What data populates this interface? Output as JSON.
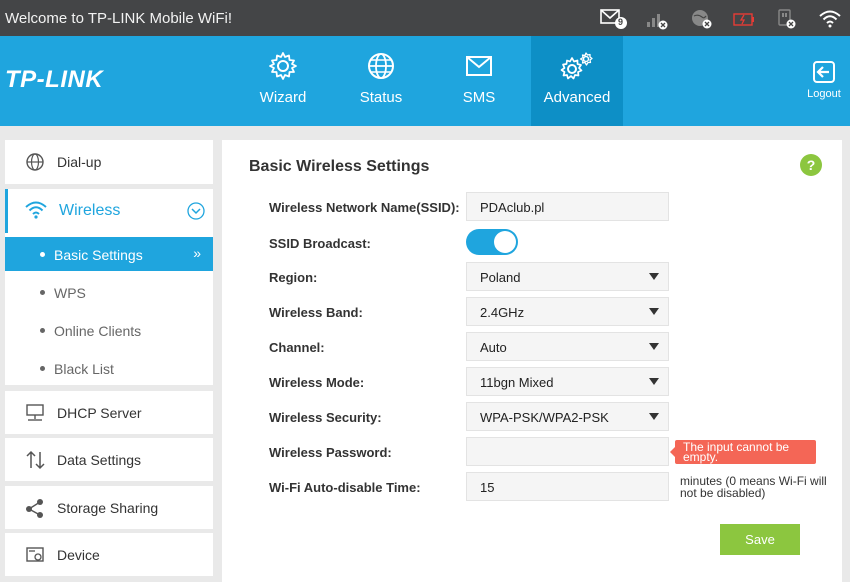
{
  "window": {
    "title": "Welcome to TP-LINK Mobile WiFi!"
  },
  "status_bar": {
    "message_count": "9",
    "icons": [
      "mail-icon",
      "signal-icon",
      "globe-icon",
      "battery-icon",
      "sim-icon",
      "wifi-icon"
    ],
    "battery_color": "#e83b36"
  },
  "header": {
    "logo": "TP-LINK",
    "tabs": [
      {
        "label": "Wizard",
        "icon": "gear-icon"
      },
      {
        "label": "Status",
        "icon": "globe-icon"
      },
      {
        "label": "SMS",
        "icon": "envelope-icon"
      },
      {
        "label": "Advanced",
        "icon": "gears-icon"
      }
    ],
    "active_tab": "Advanced",
    "logout_label": "Logout",
    "brand_color": "#1fa5de"
  },
  "sidebar": {
    "items": [
      {
        "label": "Dial-up",
        "icon": "globe-icon"
      },
      {
        "label": "Wireless",
        "icon": "wifi-icon"
      },
      {
        "label": "DHCP Server",
        "icon": "server-icon"
      },
      {
        "label": "Data Settings",
        "icon": "arrows-icon"
      },
      {
        "label": "Storage Sharing",
        "icon": "share-icon"
      },
      {
        "label": "Device",
        "icon": "device-icon"
      }
    ],
    "wireless_subitems": [
      {
        "label": "Basic Settings"
      },
      {
        "label": "WPS"
      },
      {
        "label": "Online Clients"
      },
      {
        "label": "Black List"
      }
    ],
    "active_subitem": "Basic Settings"
  },
  "main": {
    "title": "Basic Wireless Settings",
    "help": "?",
    "fields": {
      "ssid": {
        "label": "Wireless Network Name(SSID):",
        "value": "PDAclub.pl"
      },
      "broadcast": {
        "label": "SSID Broadcast:",
        "on": true
      },
      "region": {
        "label": "Region:",
        "value": "Poland"
      },
      "band": {
        "label": "Wireless Band:",
        "value": "2.4GHz"
      },
      "channel": {
        "label": "Channel:",
        "value": "Auto"
      },
      "mode": {
        "label": "Wireless Mode:",
        "value": "11bgn Mixed"
      },
      "security": {
        "label": "Wireless Security:",
        "value": "WPA-PSK/WPA2-PSK"
      },
      "password": {
        "label": "Wireless Password:",
        "value": "",
        "error": "The input cannot be empty."
      },
      "autodisable": {
        "label": "Wi-Fi Auto-disable Time:",
        "value": "15",
        "hint": "minutes (0 means Wi-Fi will not be disabled)"
      }
    },
    "save_label": "Save",
    "accent_green": "#8cc63f",
    "error_color": "#f46656"
  }
}
